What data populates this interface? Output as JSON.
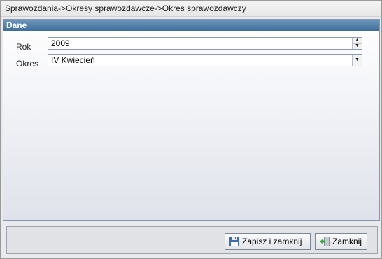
{
  "window": {
    "breadcrumb": "Sprawozdania->Okresy sprawozdawcze->Okres sprawozdawczy"
  },
  "panel": {
    "title": "Dane"
  },
  "form": {
    "rok_label": "Rok",
    "rok_value": "2009",
    "okres_label": "Okres",
    "okres_value": "IV Kwiecień"
  },
  "buttons": {
    "save_close": "Zapisz i zamknij",
    "close": "Zamknij"
  },
  "icons": {
    "save": "floppy-save-icon",
    "close": "exit-door-icon",
    "spin": "up-down-arrows-icon",
    "dropdown": "chevron-down-icon"
  }
}
